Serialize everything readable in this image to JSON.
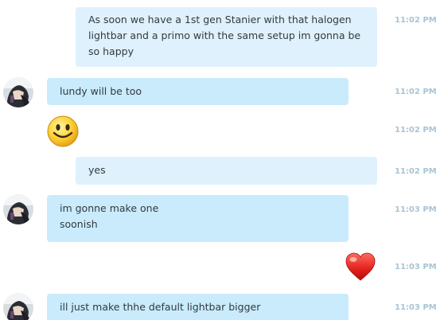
{
  "messages": [
    {
      "direction": "outgoing",
      "lines": [
        "As soon we have a 1st gen Stanier with that halogen",
        "lightbar and a primo with the same setup im gonna be",
        "so happy"
      ],
      "time": "11:02 PM"
    },
    {
      "direction": "incoming",
      "lines": [
        "lundy will be too"
      ],
      "time": "11:02 PM"
    },
    {
      "direction": "incoming",
      "emoticon": "smiley-emoticon",
      "time": "11:02 PM"
    },
    {
      "direction": "outgoing",
      "lines": [
        "yes"
      ],
      "time": "11:02 PM"
    },
    {
      "direction": "incoming",
      "lines": [
        "im gonne make one",
        "soonish"
      ],
      "time": "11:03 PM"
    },
    {
      "direction": "outgoing",
      "emoticon": "heart-emoticon",
      "time": "11:03 PM"
    },
    {
      "direction": "incoming",
      "lines": [
        "ill just make thhe default lightbar bigger"
      ],
      "time": "11:03 PM"
    }
  ],
  "colors": {
    "outgoing_bubble": "#dff1fc",
    "incoming_bubble": "#c9ebfb",
    "timestamp": "#a9c4d4",
    "text": "#333a40"
  },
  "icons": {
    "avatar": "user-avatar",
    "smiley": "smiley-emoticon",
    "heart": "heart-emoticon"
  }
}
